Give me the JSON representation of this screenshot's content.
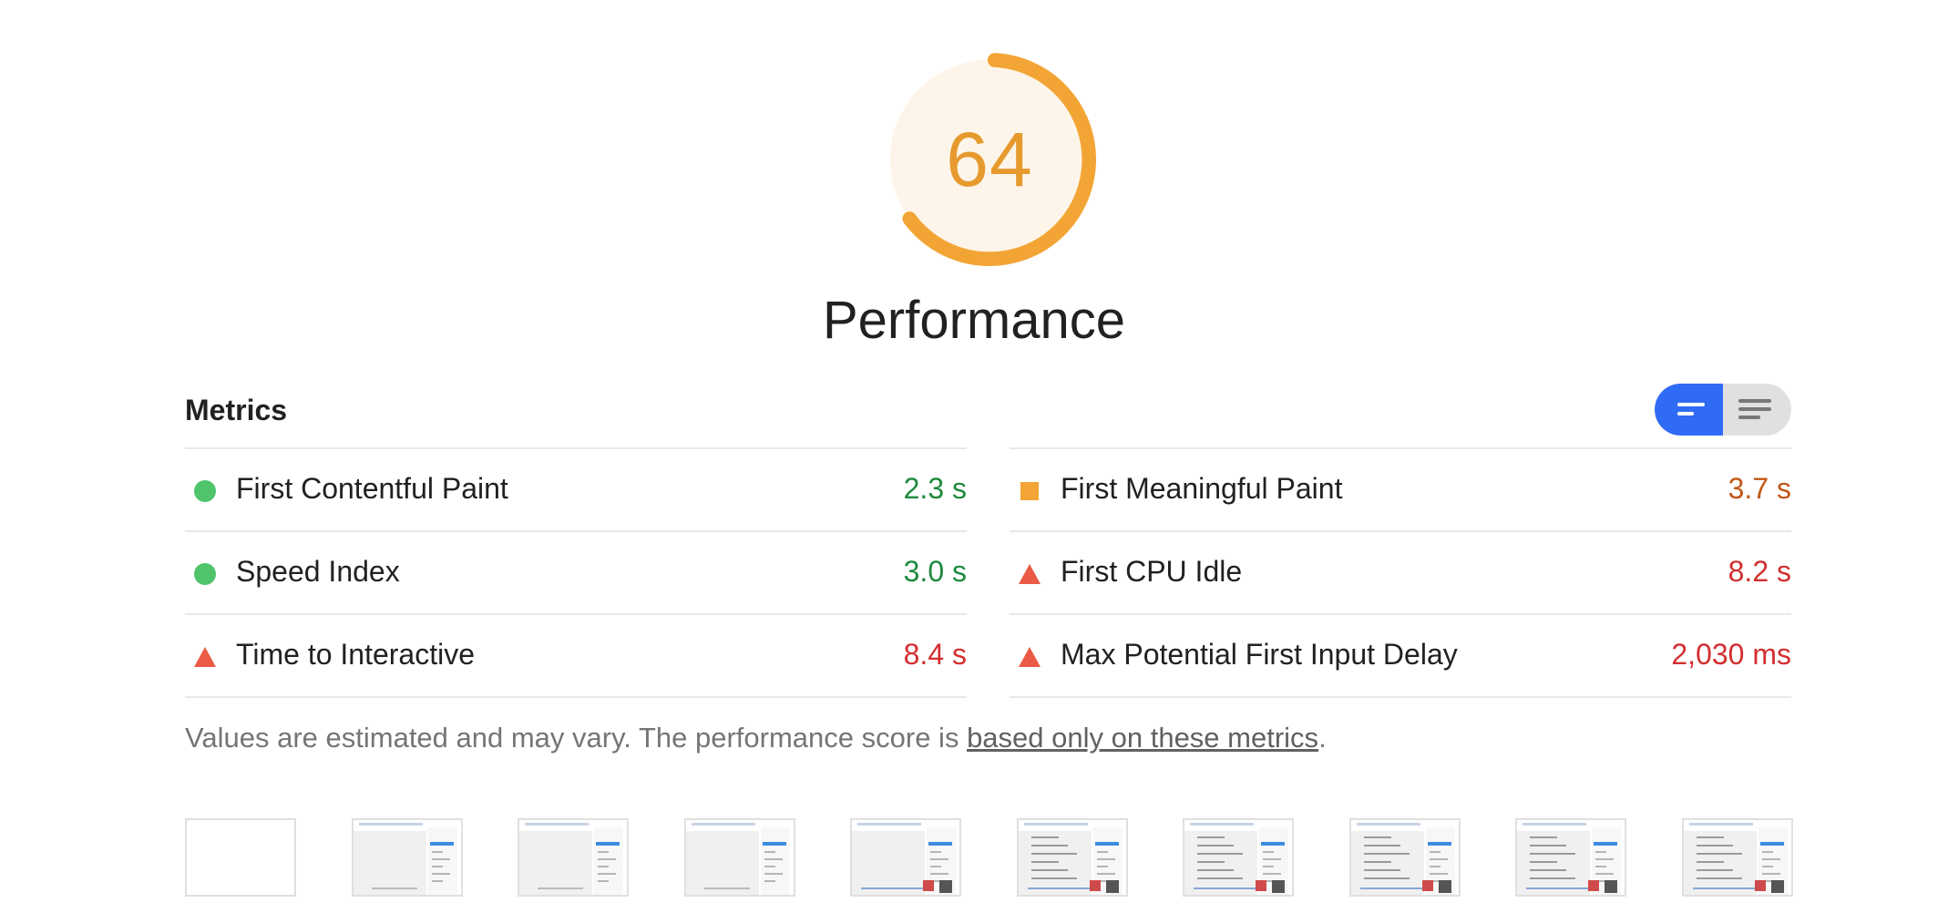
{
  "category": {
    "score": "64",
    "score_fraction": 0.64,
    "title": "Performance",
    "score_color": "#e69a2e",
    "gauge_bg_color": "#fdf5e9"
  },
  "metrics": {
    "title": "Metrics",
    "view_toggle": {
      "active": "summary",
      "options": [
        "summary-view-icon",
        "list-view-icon"
      ]
    },
    "left": [
      {
        "label": "First Contentful Paint",
        "value": "2.3 s",
        "status": "pass",
        "icon": "pass-circle-icon",
        "color": "#1e8a3e"
      },
      {
        "label": "Speed Index",
        "value": "3.0 s",
        "status": "pass",
        "icon": "pass-circle-icon",
        "color": "#1e8a3e"
      },
      {
        "label": "Time to Interactive",
        "value": "8.4 s",
        "status": "fail",
        "icon": "fail-triangle-icon",
        "color": "#d32f2f"
      }
    ],
    "right": [
      {
        "label": "First Meaningful Paint",
        "value": "3.7 s",
        "status": "average",
        "icon": "average-square-icon",
        "color": "#c25818"
      },
      {
        "label": "First CPU Idle",
        "value": "8.2 s",
        "status": "fail",
        "icon": "fail-triangle-icon",
        "color": "#d32f2f"
      },
      {
        "label": "Max Potential First Input Delay",
        "value": "2,030 ms",
        "status": "fail",
        "icon": "fail-triangle-icon",
        "color": "#d32f2f"
      }
    ],
    "note_prefix": "Values are estimated and may vary. The performance score is ",
    "note_link": "based only on these metrics",
    "note_suffix": "."
  },
  "filmstrip": {
    "frames": [
      {
        "state": "blank"
      },
      {
        "state": "loading"
      },
      {
        "state": "loading"
      },
      {
        "state": "loading"
      },
      {
        "state": "partial"
      },
      {
        "state": "loaded"
      },
      {
        "state": "loaded"
      },
      {
        "state": "loaded"
      },
      {
        "state": "loaded"
      },
      {
        "state": "loaded"
      }
    ]
  }
}
